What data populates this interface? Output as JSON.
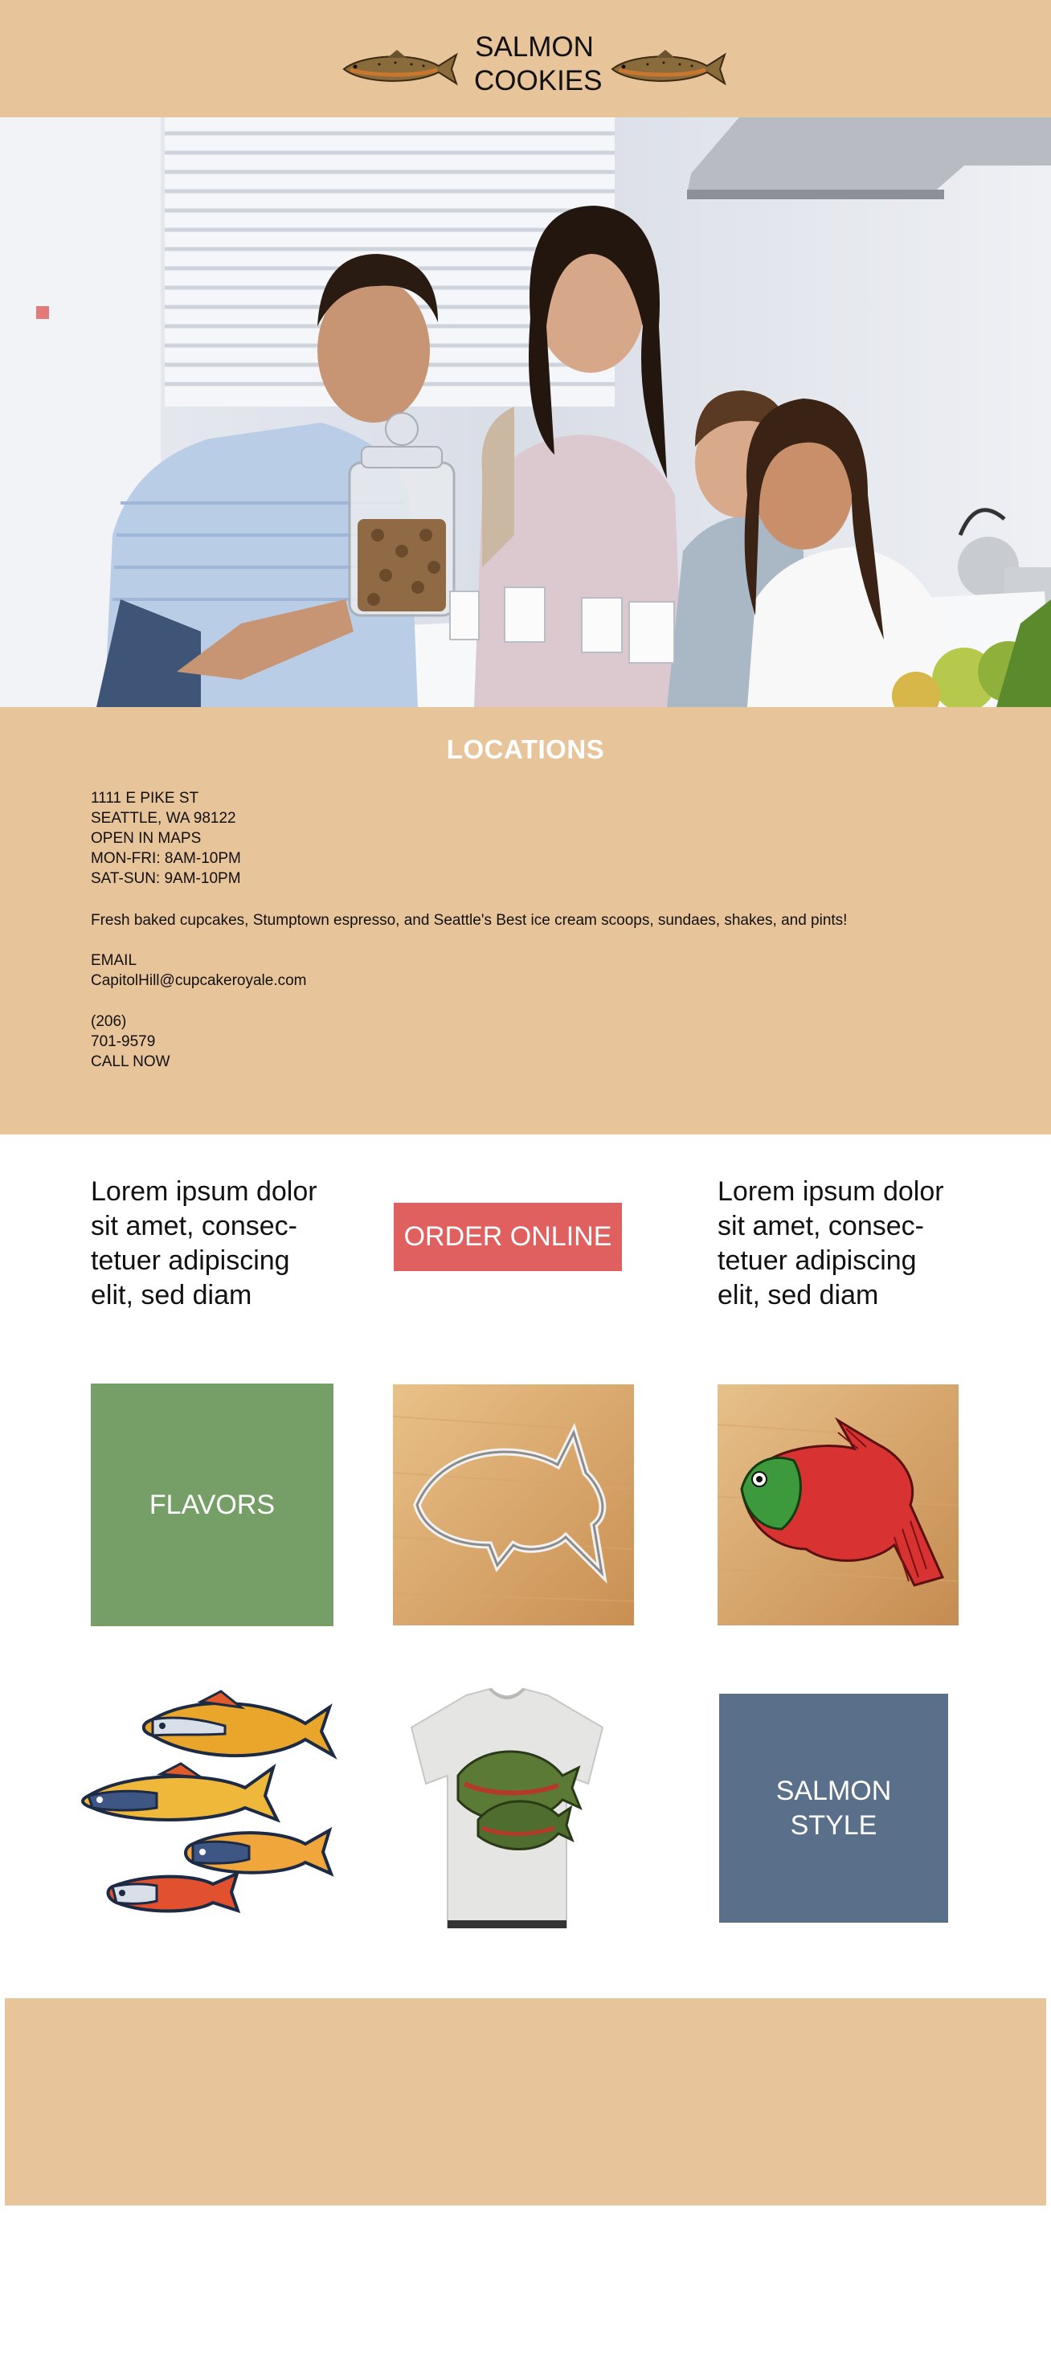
{
  "header": {
    "brand_line1": "SALMON",
    "brand_line2": "COOKIES",
    "logo_icon": "salmon-fish-icon"
  },
  "hero": {
    "image": "family-kitchen-photo"
  },
  "locations": {
    "title": "LOCATIONS",
    "address_line1": "1111 E PIKE ST",
    "address_line2": "SEATTLE, WA 98122",
    "maps_link": "OPEN IN MAPS",
    "hours_weekday": "MON-FRI: 8AM-10PM",
    "hours_weekend": "SAT-SUN: 9AM-10PM",
    "description": "Fresh baked cupcakes, Stumptown espresso, and Seattle's Best ice cream scoops, sundaes, shakes, and pints!",
    "email_label": "EMAIL",
    "email_value": "CapitolHill@cupcakeroyale.com",
    "phone_area": "(206)",
    "phone_number": "701-9579",
    "call_link": "CALL NOW"
  },
  "promo": {
    "lorem_left": "Lorem ipsum dolor sit amet, consec-tetuer adipiscing elit, sed diam",
    "lorem_right": "Lorem ipsum dolor sit amet, consec-tetuer adipiscing elit, sed diam",
    "order_button": "ORDER ONLINE"
  },
  "tiles": {
    "flavors_label": "FLAVORS",
    "style_line1": "SALMON",
    "style_line2": "STYLE"
  },
  "colors": {
    "sand": "#e8c49b",
    "order_red": "#e0605f",
    "flavors_green": "#759f66",
    "style_slate": "#5a6f89"
  }
}
